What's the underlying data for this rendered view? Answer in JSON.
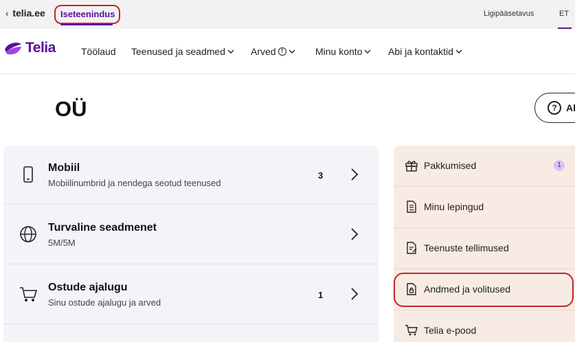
{
  "topbar": {
    "back_label": "telia.ee",
    "active_tab": "Iseteenindus",
    "accessibility": "Ligipääsetavus",
    "language": "ET"
  },
  "nav": {
    "logo_text": "Telia",
    "items": [
      {
        "label": "Töölaud"
      },
      {
        "label": "Teenused ja seadmed"
      },
      {
        "label": "Arved"
      },
      {
        "label": "Minu konto"
      },
      {
        "label": "Abi ja kontaktid"
      }
    ]
  },
  "company": {
    "name": "OÜ"
  },
  "help_button": {
    "label": "Ab"
  },
  "services": [
    {
      "title": "Mobiil",
      "subtitle": "Mobiilinumbrid ja nendega seotud teenused",
      "count": "3",
      "icon": "phone-icon"
    },
    {
      "title": "Turvaline seadmenet",
      "subtitle": "5M/5M",
      "count": "",
      "icon": "globe-icon"
    },
    {
      "title": "Ostude ajalugu",
      "subtitle": "Sinu ostude ajalugu ja arved",
      "count": "1",
      "icon": "cart-icon"
    }
  ],
  "sidebar": [
    {
      "label": "Pakkumised",
      "badge": "1",
      "icon": "gift-icon"
    },
    {
      "label": "Minu lepingud",
      "icon": "contract-icon"
    },
    {
      "label": "Teenuste tellimused",
      "icon": "order-icon"
    },
    {
      "label": "Andmed ja volitused",
      "icon": "document-lock-icon"
    },
    {
      "label": "Telia e-pood",
      "icon": "cart-icon"
    }
  ],
  "colors": {
    "brand": "#5a0f9a",
    "highlight_ring": "#c0262e",
    "sidebar_bg": "#f7ebe3",
    "card_bg": "#f4f4f8"
  }
}
